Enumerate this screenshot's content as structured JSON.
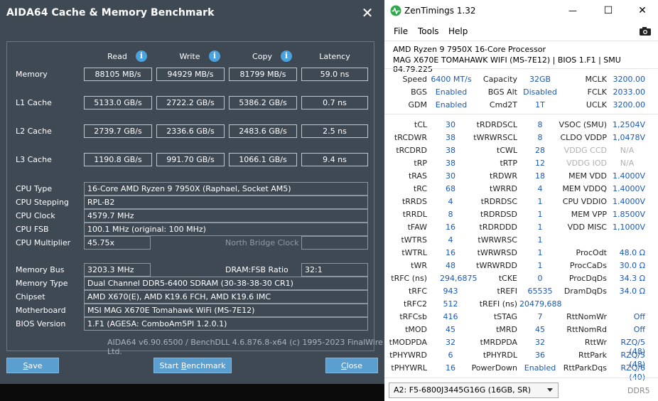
{
  "aida": {
    "title": "AIDA64 Cache & Memory Benchmark",
    "close_glyph": "✕",
    "headers": {
      "read": "Read",
      "write": "Write",
      "copy": "Copy",
      "latency": "Latency"
    },
    "info_glyph": "i",
    "rows": [
      {
        "label": "Memory",
        "read": "88105 MB/s",
        "write": "94929 MB/s",
        "copy": "81799 MB/s",
        "latency": "59.0 ns"
      },
      {
        "label": "L1 Cache",
        "read": "5133.0 GB/s",
        "write": "2722.2 GB/s",
        "copy": "5386.2 GB/s",
        "latency": "0.7 ns"
      },
      {
        "label": "L2 Cache",
        "read": "2739.7 GB/s",
        "write": "2336.6 GB/s",
        "copy": "2483.6 GB/s",
        "latency": "2.5 ns"
      },
      {
        "label": "L3 Cache",
        "read": "1190.8 GB/s",
        "write": "991.70 GB/s",
        "copy": "1066.1 GB/s",
        "latency": "9.4 ns"
      }
    ],
    "cpu_type_label": "CPU Type",
    "cpu_type": "16-Core AMD Ryzen 9 7950X  (Raphael, Socket AM5)",
    "cpu_stepping_label": "CPU Stepping",
    "cpu_stepping": "RPL-B2",
    "cpu_clock_label": "CPU Clock",
    "cpu_clock": "4579.7 MHz",
    "cpu_fsb_label": "CPU FSB",
    "cpu_fsb": "100.1 MHz  (original: 100 MHz)",
    "cpu_mult_label": "CPU Multiplier",
    "cpu_mult": "45.75x",
    "nb_clock_label": "North Bridge Clock",
    "nb_clock": "",
    "mem_bus_label": "Memory Bus",
    "mem_bus": "3203.3 MHz",
    "dram_fsb_label": "DRAM:FSB Ratio",
    "dram_fsb": "32:1",
    "mem_type_label": "Memory Type",
    "mem_type": "Dual Channel DDR5-6400 SDRAM  (30-38-38-30 CR1)",
    "chipset_label": "Chipset",
    "chipset": "AMD X670(E), AMD K19.6 FCH, AMD K19.6 IMC",
    "mobo_label": "Motherboard",
    "mobo": "MSI MAG X670E Tomahawk WiFi (MS-7E12)",
    "bios_label": "BIOS Version",
    "bios": "1.F1  (AGESA: ComboAm5PI 1.2.0.1)",
    "footer": "AIDA64 v6.90.6500 / BenchDLL 4.6.876.8-x64  (c) 1995-2023 FinalWire Ltd.",
    "save_btn_u": "S",
    "save_btn_rest": "ave",
    "start_btn_pre": "Start ",
    "start_btn_u": "B",
    "start_btn_rest": "enchmark",
    "close_btn_u": "C",
    "close_btn_rest": "lose"
  },
  "zen": {
    "title": "ZenTimings 1.32",
    "win_min": "—",
    "win_max": "☐",
    "win_close": "✕",
    "menu": [
      "File",
      "Tools",
      "Help"
    ],
    "cpu": "AMD Ryzen 9 7950X 16-Core Processor",
    "board": "MAG X670E TOMAHAWK WIFI (MS-7E12) | BIOS 1.F1 | SMU 84.79.225",
    "top": [
      {
        "l1": "Speed",
        "v1": "6400 MT/s",
        "l2": "Capacity",
        "v2": "32GB",
        "l3": "MCLK",
        "v3": "3200.00"
      },
      {
        "l1": "BGS",
        "v1": "Enabled",
        "l2": "BGS Alt",
        "v2": "Disabled",
        "l3": "FCLK",
        "v3": "2033.00"
      },
      {
        "l1": "GDM",
        "v1": "Enabled",
        "l2": "Cmd2T",
        "v2": "1T",
        "l3": "UCLK",
        "v3": "3200.00"
      }
    ],
    "timings": [
      {
        "l1": "tCL",
        "v1": "30",
        "l2": "tRDRDSCL",
        "v2": "8",
        "l3": "VSOC (SMU)",
        "v3": "1,2504V"
      },
      {
        "l1": "tRCDWR",
        "v1": "38",
        "l2": "tWRWRSCL",
        "v2": "8",
        "l3": "CLDO VDDP",
        "v3": "1,0478V"
      },
      {
        "l1": "tRCDRD",
        "v1": "38",
        "l2": "tCWL",
        "v2": "28",
        "l3": "VDDG CCD",
        "v3": "N/A",
        "d3": true
      },
      {
        "l1": "tRP",
        "v1": "38",
        "l2": "tRTP",
        "v2": "12",
        "l3": "VDDG IOD",
        "v3": "N/A",
        "d3": true
      },
      {
        "l1": "tRAS",
        "v1": "30",
        "l2": "tRDWR",
        "v2": "18",
        "l3": "MEM VDD",
        "v3": "1.4000V"
      },
      {
        "l1": "tRC",
        "v1": "68",
        "l2": "tWRRD",
        "v2": "4",
        "l3": "MEM VDDQ",
        "v3": "1.4000V"
      },
      {
        "l1": "tRRDS",
        "v1": "4",
        "l2": "tRDRDSC",
        "v2": "1",
        "l3": "CPU VDDIO",
        "v3": "1.4000V"
      },
      {
        "l1": "tRRDL",
        "v1": "8",
        "l2": "tRDRDSD",
        "v2": "1",
        "l3": "MEM VPP",
        "v3": "1.8500V"
      },
      {
        "l1": "tFAW",
        "v1": "16",
        "l2": "tRDRDDD",
        "v2": "1",
        "l3": "VDD MISC",
        "v3": "1,1000V"
      },
      {
        "l1": "tWTRS",
        "v1": "4",
        "l2": "tWRWRSC",
        "v2": "1",
        "l3": "",
        "v3": ""
      },
      {
        "l1": "tWTRL",
        "v1": "16",
        "l2": "tWRWRSD",
        "v2": "1",
        "l3": "ProcOdt",
        "v3": "48.0 Ω"
      },
      {
        "l1": "tWR",
        "v1": "48",
        "l2": "tWRWRDD",
        "v2": "1",
        "l3": "ProcCaDs",
        "v3": "30.0 Ω"
      },
      {
        "l1": "tRFC (ns)",
        "v1": "294,6875",
        "l2": "tCKE",
        "v2": "0",
        "l3": "ProcDqDs",
        "v3": "34.3 Ω"
      },
      {
        "l1": "tRFC",
        "v1": "943",
        "l2": "tREFI",
        "v2": "65535",
        "l3": "DramDqDs",
        "v3": "34.0 Ω"
      },
      {
        "l1": "tRFC2",
        "v1": "512",
        "l2": "tREFI (ns)",
        "v2": "20479,688",
        "l3": "",
        "v3": ""
      },
      {
        "l1": "tRFCsb",
        "v1": "416",
        "l2": "tSTAG",
        "v2": "7",
        "l3": "RttNomWr",
        "v3": "Off"
      },
      {
        "l1": "tMOD",
        "v1": "45",
        "l2": "tMRD",
        "v2": "45",
        "l3": "RttNomRd",
        "v3": "Off"
      },
      {
        "l1": "tMODPDA",
        "v1": "32",
        "l2": "tMRDPDA",
        "v2": "32",
        "l3": "RttWr",
        "v3": "RZQ/5 (48)"
      },
      {
        "l1": "tPHYWRD",
        "v1": "6",
        "l2": "tPHYRDL",
        "v2": "36",
        "l3": "RttPark",
        "v3": "RZQ/5 (48)"
      },
      {
        "l1": "tPHYWRL",
        "v1": "16",
        "l2": "PowerDown",
        "v2": "Enabled",
        "l3": "RttParkDqs",
        "v3": "RZQ/6 (40)"
      }
    ],
    "module_select": "A2: F5-6800J3445G16G (16GB, SR)",
    "ddr": "DDR5"
  }
}
